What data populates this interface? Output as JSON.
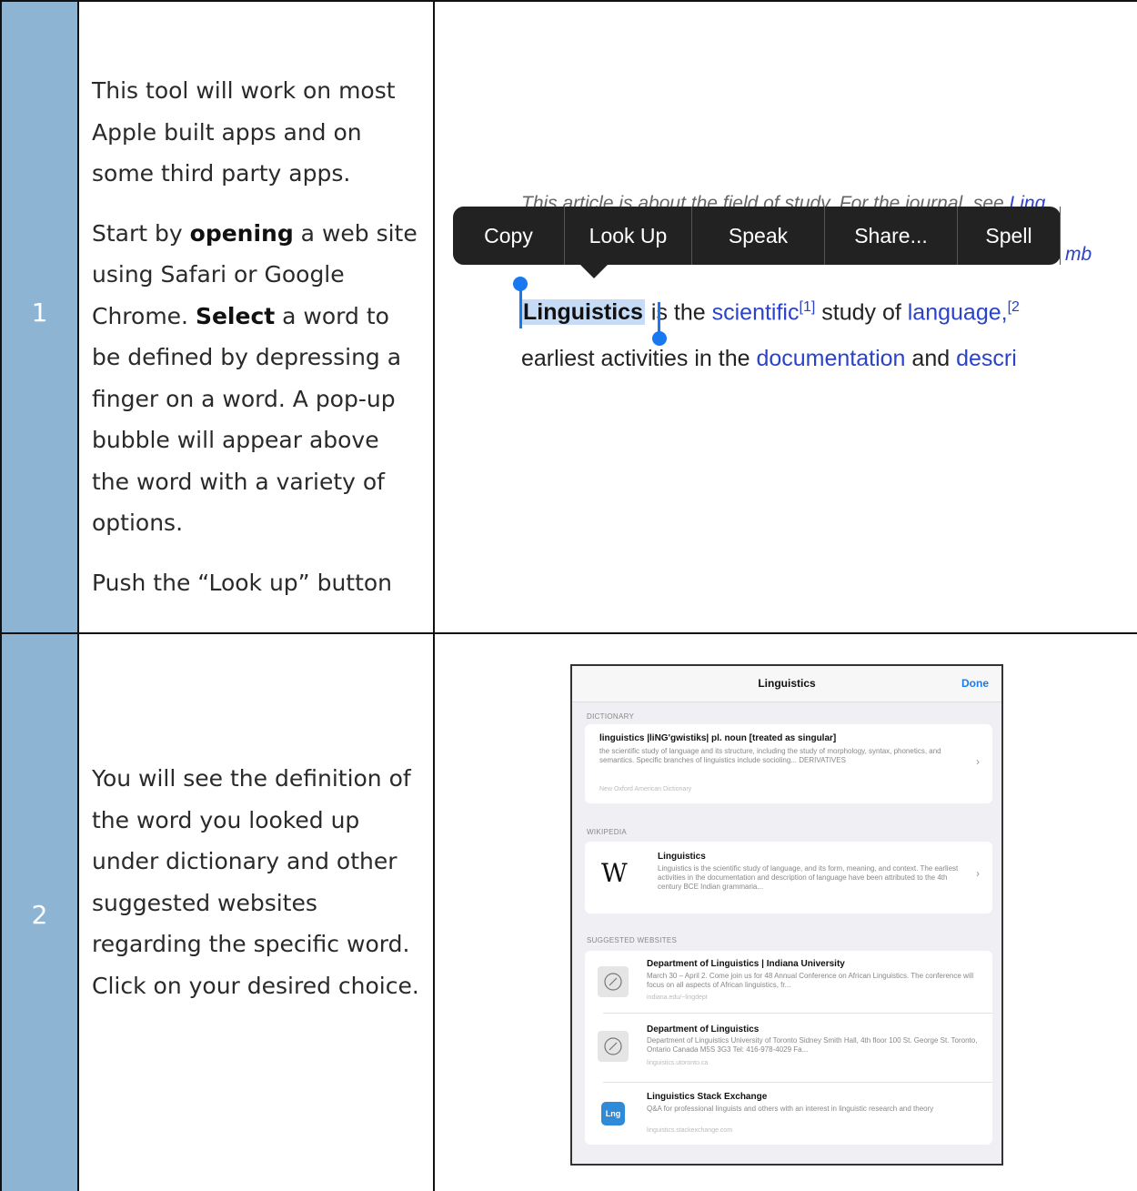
{
  "rows": [
    {
      "number": "1",
      "paragraphs": [
        [
          "This tool will work on most Apple built apps and on some third party apps."
        ],
        [
          "Start by ",
          {
            "b": "opening"
          },
          " a web site using Safari or Google Chrome.  ",
          {
            "b": "Select"
          },
          " a word to be defined by depressing a finger on a word.  A pop-up bubble will appear above the word with a variety of options."
        ],
        [
          "Push the “Look up” button"
        ]
      ]
    },
    {
      "number": "2",
      "paragraphs": [
        [
          "You will see the definition of the word you looked up under dictionary and other suggested websites regarding the specific word.  Click on your desired choice."
        ]
      ]
    }
  ],
  "shot1": {
    "ghost_text": "This article is about the field of study. For the journal, see ",
    "ghost_link": "Ling",
    "ghost_link2": "mb",
    "menu": [
      "Copy",
      "Look Up",
      "Speak",
      "Share...",
      "Spell"
    ],
    "selected_word": "Linguistics",
    "line1_after": " is the ",
    "line1_link1": "scientific",
    "line1_ref": "[1]",
    "line1_mid": " study of ",
    "line1_link2": "language,",
    "line1_ref2": "[2",
    "line2_a": "earliest activities in the ",
    "line2_link1": "documentation",
    "line2_b": " and ",
    "line2_link2": "descri"
  },
  "shot2": {
    "title": "Linguistics",
    "done": "Done",
    "dictionary_label": "DICTIONARY",
    "dict_title": "linguistics |liNG'gwistiks| pl. noun [treated as singular]",
    "dict_text": "the scientific study of language and its structure, including the study of morphology, syntax, phonetics, and semantics. Specific branches of linguistics include socioling... DERIVATIVES",
    "dict_src": "New Oxford American Dictionary",
    "wikipedia_label": "WIKIPEDIA",
    "wiki_title": "Linguistics",
    "wiki_text": "Linguistics is the scientific study of language, and its form, meaning, and context. The earliest activities in the documentation and description of language have been attributed to the 4th century BCE Indian grammaria...",
    "suggested_label": "SUGGESTED WEBSITES",
    "sites": [
      {
        "title": "Department of Linguistics | Indiana University",
        "text": "March 30 – April 2. Come join us for 48 Annual Conference on African Linguistics. The conference will focus on all aspects of African linguistics, fr...",
        "src": "indiana.edu/~lingdept",
        "icon": "compass-icon"
      },
      {
        "title": "Department of Linguistics",
        "text": "Department of Linguistics University of Toronto Sidney Smith Hall, 4th floor 100 St. George St. Toronto, Ontario Canada M5S 3G3 Tel: 416-978-4029 Fa...",
        "src": "linguistics.utoronto.ca",
        "icon": "compass-icon"
      },
      {
        "title": "Linguistics Stack Exchange",
        "text": "Q&A for professional linguists and others with an interest in linguistic research and theory",
        "src": "linguistics.stackexchange.com",
        "icon": "Lng"
      }
    ]
  }
}
